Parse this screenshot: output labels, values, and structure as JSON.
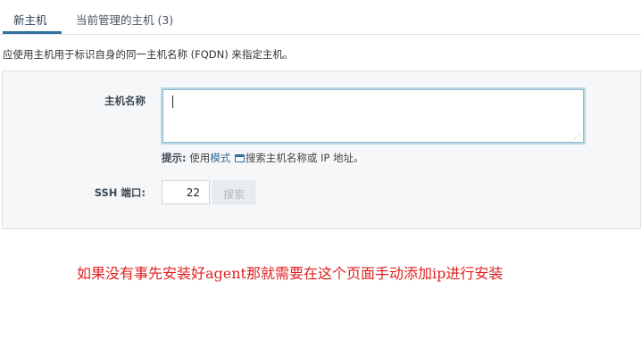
{
  "tabs": [
    {
      "label": "新主机",
      "active": true
    },
    {
      "label": "当前管理的主机 (3)",
      "active": false
    }
  ],
  "intro_text": "应使用主机用于标识自身的同一主机名称 (FQDN) 来指定主机。",
  "form": {
    "hostname_label": "主机名称",
    "hostname_value": "",
    "hint_prefix": "提示:",
    "hint_before": " 使用",
    "hint_link": "模式",
    "hint_icon": "window-icon",
    "hint_after": "搜索主机名称或 IP 地址。",
    "ssh_port_label": "SSH 端口:",
    "ssh_port_value": "22",
    "search_button_label": "搜索"
  },
  "annotation": "如果没有事先安装好agent那就需要在这个页面手动添加ip进行安装",
  "colors": {
    "accent": "#2f6f9e",
    "annotation": "#e02020",
    "panel": "#f6f7f8"
  }
}
